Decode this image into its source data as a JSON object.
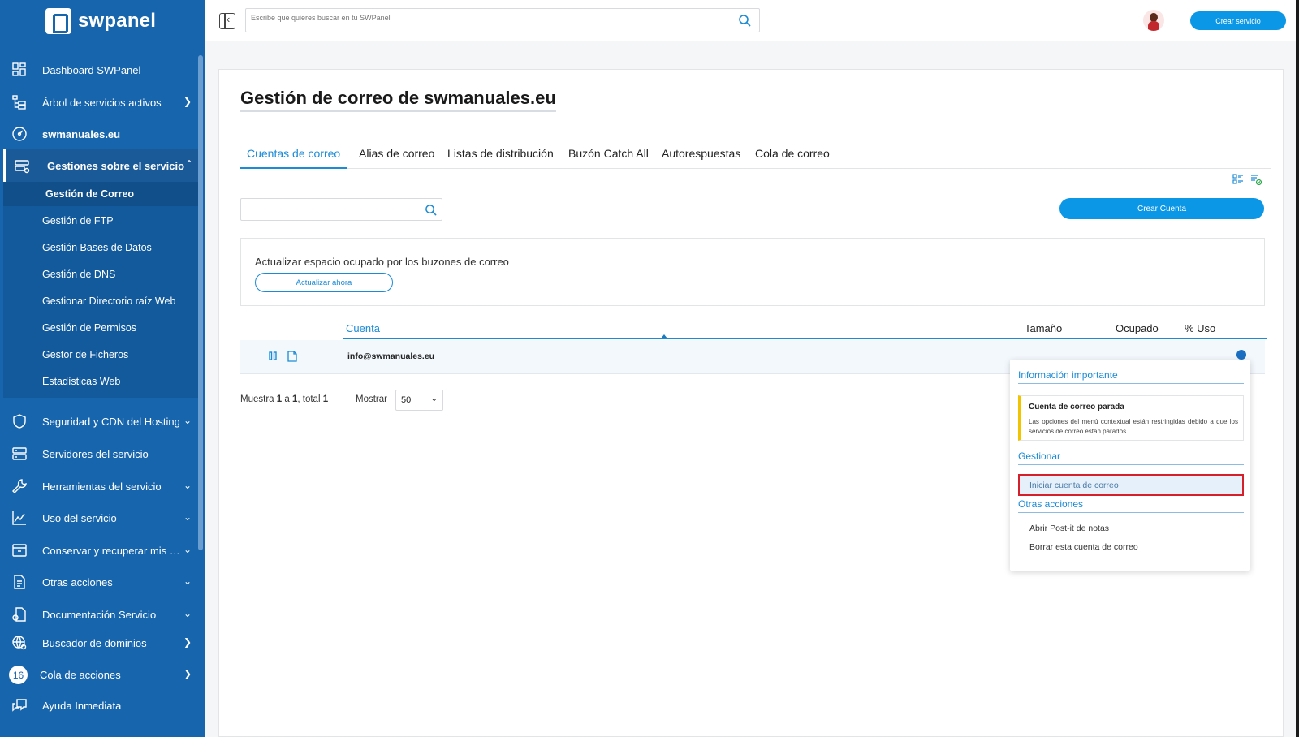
{
  "brand": {
    "name": "swpanel"
  },
  "topbar": {
    "search_placeholder": "Escribe que quieres buscar en tu SWPanel",
    "create_service": "Crear servicio"
  },
  "sidebar": {
    "items": [
      {
        "label": "Dashboard SWPanel",
        "icon": "dashboard-icon"
      },
      {
        "label": "Árbol de servicios activos",
        "icon": "tree-icon"
      },
      {
        "label": "swmanuales.eu",
        "icon": "gauge-icon"
      },
      {
        "label": "Gestiones sobre el servicio",
        "icon": "server-settings-icon"
      },
      {
        "label": "Seguridad y CDN del Hosting",
        "icon": "shield-icon"
      },
      {
        "label": "Servidores del servicio",
        "icon": "servers-icon"
      },
      {
        "label": "Herramientas del servicio",
        "icon": "wrench-icon"
      },
      {
        "label": "Uso del servicio",
        "icon": "chart-icon"
      },
      {
        "label": "Conservar y recuperar mis dat...",
        "icon": "archive-icon"
      },
      {
        "label": "Otras acciones",
        "icon": "document-icon"
      },
      {
        "label": "Documentación Servicio",
        "icon": "docs-icon"
      },
      {
        "label": "Buscador de dominios",
        "icon": "globe-icon"
      },
      {
        "label": "Cola de acciones",
        "icon": "queue-icon",
        "badge": "16"
      },
      {
        "label": "Ayuda Inmediata",
        "icon": "chat-icon"
      }
    ],
    "subitems": [
      "Gestión de Correo",
      "Gestión de FTP",
      "Gestión Bases de Datos",
      "Gestión de DNS",
      "Gestionar Directorio raíz Web",
      "Gestión de Permisos",
      "Gestor de Ficheros",
      "Estadísticas Web"
    ]
  },
  "main": {
    "title": "Gestión de correo de swmanuales.eu",
    "tabs": [
      "Cuentas de correo",
      "Alias de correo",
      "Listas de distribución",
      "Buzón Catch All",
      "Autorespuestas",
      "Cola de correo"
    ],
    "create_account": "Crear Cuenta",
    "update_text": "Actualizar espacio ocupado por los buzones de correo",
    "update_button": "Actualizar ahora",
    "columns": {
      "account": "Cuenta",
      "size": "Tamaño",
      "used": "Ocupado",
      "usage": "% Uso"
    },
    "rows": [
      {
        "email": "info@swmanuales.eu"
      }
    ],
    "pager": {
      "prefix": "Muestra",
      "from": "1",
      "a": "a",
      "to": "1",
      "total_label": ", total",
      "total": "1"
    },
    "show_label": "Mostrar",
    "show_value": "50"
  },
  "context_menu": {
    "info_header": "Información importante",
    "note_title": "Cuenta de correo parada",
    "note_text": "Las opciones del menú contextual están restringidas debido a que los servicios de correo están parados.",
    "manage_header": "Gestionar",
    "start_account": "Iniciar cuenta de correo",
    "other_header": "Otras acciones",
    "other_items": [
      "Abrir Post-it de notas",
      "Borrar esta cuenta de correo"
    ]
  }
}
